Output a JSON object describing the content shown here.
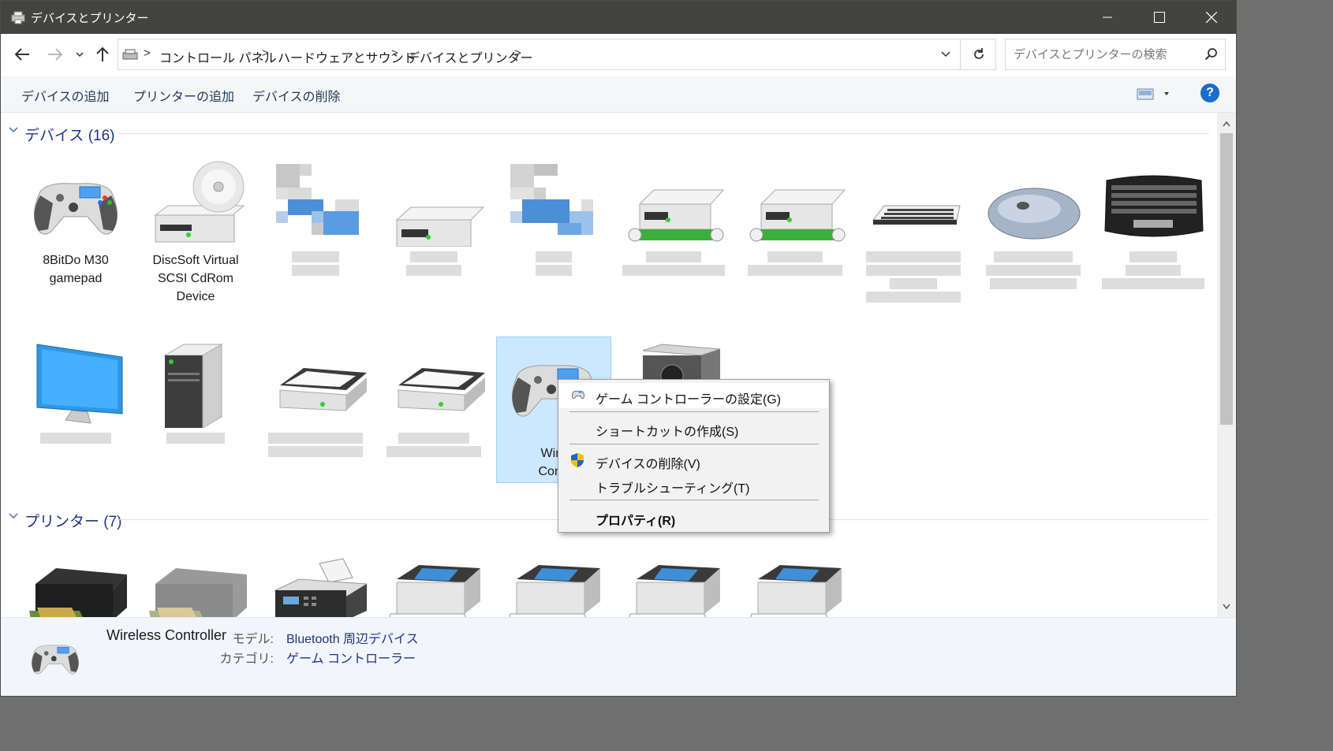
{
  "window": {
    "title": "デバイスとプリンター",
    "minimize": "minimize",
    "maximize": "maximize",
    "close": "close"
  },
  "nav": {
    "breadcrumbs": [
      "コントロール パネル",
      "ハードウェアとサウンド",
      "デバイスとプリンター"
    ],
    "separator": ">",
    "search_placeholder": "デバイスとプリンターの検索"
  },
  "commands": {
    "add_device": "デバイスの追加",
    "add_printer": "プリンターの追加",
    "remove_device": "デバイスの削除",
    "help": "?"
  },
  "devices": {
    "header": "デバイス (16)",
    "items": [
      {
        "name_line1": "8BitDo M30",
        "name_line2": "gamepad",
        "icon": "gamepad-icon"
      },
      {
        "name_line1": "DiscSoft Virtual",
        "name_line2": "SCSI CdRom",
        "name_line3": "Device",
        "icon": "cdrom-drive-icon"
      },
      {
        "icon": "pixelated-device-icon"
      },
      {
        "icon": "drive-icon"
      },
      {
        "icon": "pixelated-device-icon"
      },
      {
        "icon": "network-drive-icon"
      },
      {
        "icon": "network-drive-icon"
      },
      {
        "icon": "keyboard-icon"
      },
      {
        "icon": "mouse-icon"
      },
      {
        "icon": "ergonomic-keyboard-icon"
      },
      {
        "icon": "monitor-icon"
      },
      {
        "icon": "computer-tower-icon"
      },
      {
        "icon": "scanner-icon"
      },
      {
        "icon": "scanner-icon"
      },
      {
        "name_line1": "Wire",
        "name_line2": "Contr",
        "icon": "gamepad-icon"
      },
      {
        "icon": "speaker-icon"
      }
    ]
  },
  "printers": {
    "header": "プリンター (7)",
    "items": [
      {
        "icon": "photo-printer-icon"
      },
      {
        "icon": "photo-printer-gray-icon"
      },
      {
        "icon": "fax-icon"
      },
      {
        "icon": "printer-icon"
      },
      {
        "icon": "printer-icon"
      },
      {
        "icon": "printer-icon"
      },
      {
        "icon": "printer-icon"
      }
    ]
  },
  "context_menu": {
    "game_controller_settings": "ゲーム コントローラーの設定(G)",
    "create_shortcut": "ショートカットの作成(S)",
    "remove_device": "デバイスの削除(V)",
    "troubleshoot": "トラブルシューティング(T)",
    "properties": "プロパティ(R)"
  },
  "details": {
    "device_name": "Wireless Controller",
    "model_label": "モデル:",
    "model_value": "Bluetooth 周辺デバイス",
    "category_label": "カテゴリ:",
    "category_value": "ゲーム コントローラー"
  },
  "colors": {
    "titlebar": "#434340",
    "link_blue": "#1e3287",
    "selection": "#cce8ff",
    "command_text": "#1e395b"
  }
}
